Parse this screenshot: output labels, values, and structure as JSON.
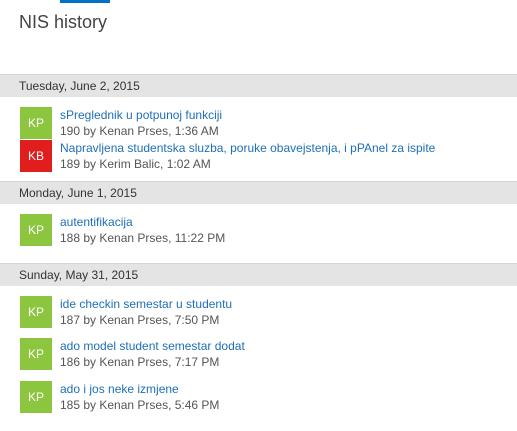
{
  "page": {
    "title": "NIS history"
  },
  "colors": {
    "accent": "#0072c6",
    "avatar_kp": "#8cc63f",
    "avatar_kb": "#e01e1e",
    "link": "#1e6fb8"
  },
  "days": [
    {
      "date": "Tuesday, June 2, 2015",
      "commits": [
        {
          "initials": "KP",
          "avatar_color": "#8cc63f",
          "title": "sPreglednik u potpunoj funkciji",
          "meta": "190 by Kenan Prses, 1:36 AM"
        },
        {
          "initials": "KB",
          "avatar_color": "#e01e1e",
          "title": "Napravljena studentska sluzba, poruke obavejstenja, i pPAnel za ispite",
          "meta": "189 by Kerim Balic, 1:02 AM"
        }
      ]
    },
    {
      "date": "Monday, June 1, 2015",
      "commits": [
        {
          "initials": "KP",
          "avatar_color": "#8cc63f",
          "title": "autentifikacija",
          "meta": "188 by Kenan Prses, 11:22 PM"
        }
      ]
    },
    {
      "date": "Sunday, May 31, 2015",
      "commits": [
        {
          "initials": "KP",
          "avatar_color": "#8cc63f",
          "title": "ide checkin semestar u studentu",
          "meta": "187 by Kenan Prses, 7:50 PM"
        },
        {
          "initials": "KP",
          "avatar_color": "#8cc63f",
          "title": "ado model student semestar dodat",
          "meta": "186 by Kenan Prses, 7:17 PM"
        },
        {
          "initials": "KP",
          "avatar_color": "#8cc63f",
          "title": "ado i jos neke izmjene",
          "meta": "185 by Kenan Prses, 5:46 PM"
        }
      ]
    }
  ]
}
